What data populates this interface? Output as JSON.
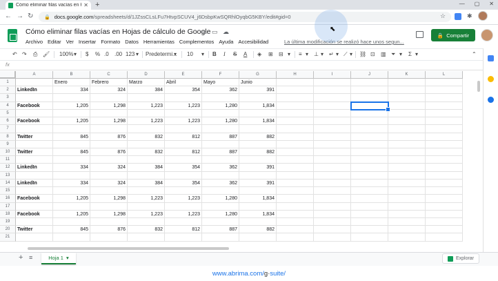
{
  "browser": {
    "tab_title": "Cómo eliminar filas vacías en Ho...",
    "url_host": "docs.google.com",
    "url_path": "/spreadsheets/d/1JZssCLsLFu7HtvpSCUV4_j6DsbpKwSQRhlOyqbG5KBY/edit#gid=0"
  },
  "doc": {
    "title": "Cómo eliminar filas vacías en Hojas de cálculo de Google",
    "menu": [
      "Archivo",
      "Editar",
      "Ver",
      "Insertar",
      "Formato",
      "Datos",
      "Herramientas",
      "Complementos",
      "Ayuda",
      "Accesibilidad"
    ],
    "last_edit": "La última modificación se realizó hace unos segun...",
    "share_label": "Compartir"
  },
  "toolbar": {
    "zoom": "100%",
    "currency": "$",
    "percent": "%",
    "dec_less": ".0",
    "dec_more": ".00",
    "format_123": "123",
    "font": "Predetermi...",
    "font_size": "10"
  },
  "formula_bar": {
    "label": "fx",
    "value": ""
  },
  "grid": {
    "columns": [
      "A",
      "B",
      "C",
      "D",
      "E",
      "F",
      "G",
      "H",
      "I",
      "J",
      "K",
      "L"
    ],
    "rows": [
      {
        "n": "1",
        "cells": [
          "",
          "Enero",
          "Febrero",
          "Marzo",
          "Abril",
          "Mayo",
          "Junio"
        ]
      },
      {
        "n": "2",
        "cells": [
          "LinkedIn",
          "334",
          "324",
          "384",
          "354",
          "362",
          "391"
        ]
      },
      {
        "n": "3",
        "cells": [
          "",
          "",
          "",
          "",
          "",
          "",
          ""
        ]
      },
      {
        "n": "4",
        "cells": [
          "Facebook",
          "1,205",
          "1,298",
          "1,223",
          "1,223",
          "1,280",
          "1,834"
        ]
      },
      {
        "n": "5",
        "cells": [
          "",
          "",
          "",
          "",
          "",
          "",
          ""
        ]
      },
      {
        "n": "6",
        "cells": [
          "Facebook",
          "1,205",
          "1,298",
          "1,223",
          "1,223",
          "1,280",
          "1,834"
        ]
      },
      {
        "n": "7",
        "cells": [
          "",
          "",
          "",
          "",
          "",
          "",
          ""
        ]
      },
      {
        "n": "8",
        "cells": [
          "Twitter",
          "845",
          "876",
          "832",
          "812",
          "887",
          "882"
        ]
      },
      {
        "n": "9",
        "cells": [
          "",
          "",
          "",
          "",
          "",
          "",
          ""
        ]
      },
      {
        "n": "10",
        "cells": [
          "Twitter",
          "845",
          "876",
          "832",
          "812",
          "887",
          "882"
        ]
      },
      {
        "n": "11",
        "cells": [
          "",
          "",
          "",
          "",
          "",
          "",
          ""
        ]
      },
      {
        "n": "12",
        "cells": [
          "LinkedIn",
          "334",
          "324",
          "384",
          "354",
          "362",
          "391"
        ]
      },
      {
        "n": "13",
        "cells": [
          "",
          "",
          "",
          "",
          "",
          "",
          ""
        ]
      },
      {
        "n": "14",
        "cells": [
          "LinkedIn",
          "334",
          "324",
          "384",
          "354",
          "362",
          "391"
        ]
      },
      {
        "n": "15",
        "cells": [
          "",
          "",
          "",
          "",
          "",
          "",
          ""
        ]
      },
      {
        "n": "16",
        "cells": [
          "Facebook",
          "1,205",
          "1,298",
          "1,223",
          "1,223",
          "1,280",
          "1,834"
        ]
      },
      {
        "n": "17",
        "cells": [
          "",
          "",
          "",
          "",
          "",
          "",
          ""
        ]
      },
      {
        "n": "18",
        "cells": [
          "Facebook",
          "1,205",
          "1,298",
          "1,223",
          "1,223",
          "1,280",
          "1,834"
        ]
      },
      {
        "n": "19",
        "cells": [
          "",
          "",
          "",
          "",
          "",
          "",
          ""
        ]
      },
      {
        "n": "20",
        "cells": [
          "Twitter",
          "845",
          "876",
          "832",
          "812",
          "887",
          "882"
        ]
      },
      {
        "n": "21",
        "cells": [
          "",
          "",
          "",
          "",
          "",
          "",
          ""
        ]
      }
    ],
    "selected_cell": "J4"
  },
  "sheets": {
    "active_tab": "Hoja 1",
    "explore_label": "Explorar"
  },
  "footer": {
    "prefix": "www.abrima.com/",
    "g": "g",
    "suffix": "suite/"
  },
  "colors": {
    "accent": "#1a73e8",
    "brand_green": "#188038"
  }
}
